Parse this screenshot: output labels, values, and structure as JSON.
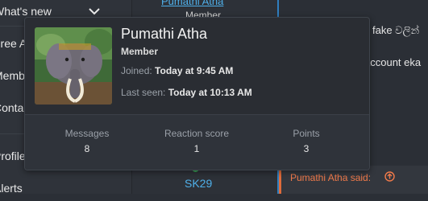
{
  "sidebar": {
    "items": [
      {
        "label": "What's new"
      },
      {
        "label": "Free A"
      },
      {
        "label": "Memb"
      },
      {
        "label": "Conta"
      },
      {
        "label": "Profile"
      },
      {
        "label": "Alerts"
      }
    ]
  },
  "thread": {
    "post_author": "Pumathi Atha",
    "post_author_role": "Member",
    "other_user": "SK29",
    "content_line1": "fake වලින් ",
    "content_line2": "account eka",
    "quote_label": "Pumathi Atha said:"
  },
  "popup": {
    "username": "Pumathi Atha",
    "role": "Member",
    "joined_label": "Joined:",
    "joined_value": "Today at 9:45 AM",
    "last_seen_label": "Last seen:",
    "last_seen_value": "Today at 10:13 AM",
    "stats": [
      {
        "label": "Messages",
        "value": "8"
      },
      {
        "label": "Reaction score",
        "value": "1"
      },
      {
        "label": "Points",
        "value": "3"
      }
    ]
  },
  "colors": {
    "accent_link": "#4fb0ea",
    "quote_orange": "#f07a4a",
    "online_green": "#3aa657"
  }
}
